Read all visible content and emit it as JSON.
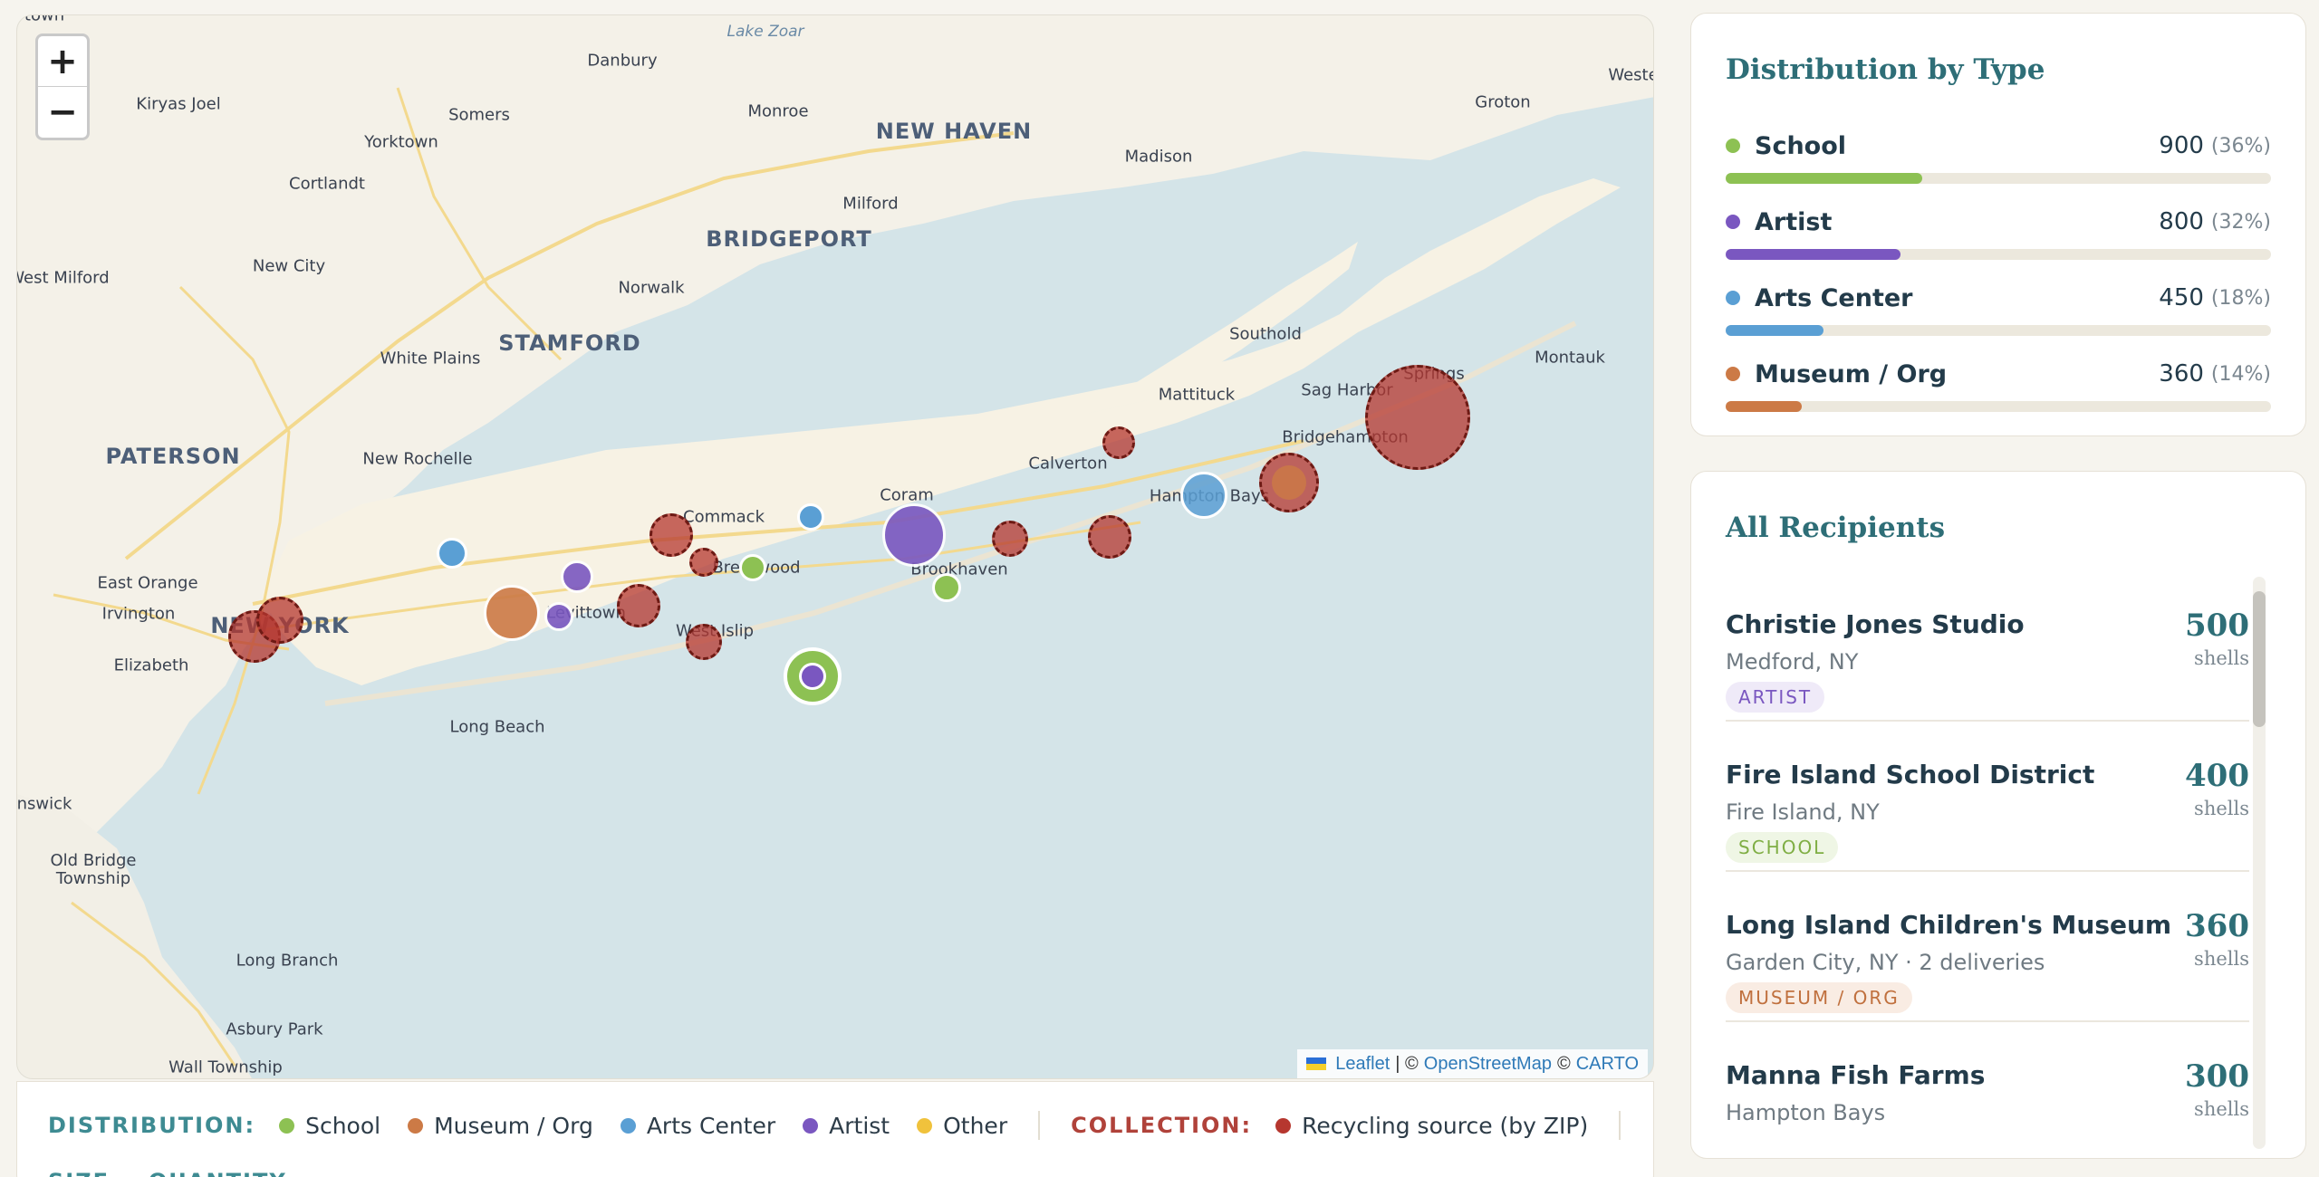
{
  "map": {
    "zoom_in_label": "+",
    "zoom_out_label": "−",
    "attribution": {
      "leaflet": "Leaflet",
      "sep1": "| ©",
      "osm": "OpenStreetMap",
      "sep2": "©",
      "carto": "CARTO"
    },
    "labels": {
      "lake_zoar": "Lake Zoar",
      "town_top_left": "town",
      "danbury": "Danbury",
      "west": "Weste",
      "kiryas_joel": "Kiryas Joel",
      "somers": "Somers",
      "monroe": "Monroe",
      "new_haven": "NEW HAVEN",
      "groton": "Groton",
      "yorktown": "Yorktown",
      "madison": "Madison",
      "cortlandt": "Cortlandt",
      "milford": "Milford",
      "bridgeport": "BRIDGEPORT",
      "new_city": "New City",
      "west_milford": "West Milford",
      "norwalk": "Norwalk",
      "southold": "Southold",
      "stamford": "STAMFORD",
      "white_plains": "White Plains",
      "montauk": "Montauk",
      "springs": "Springs",
      "mattituck": "Mattituck",
      "sag_harbor": "Sag Harbor",
      "bridgehampton": "Bridgehampton",
      "paterson": "PATERSON",
      "new_rochelle": "New Rochelle",
      "calverton": "Calverton",
      "coram": "Coram",
      "hampton_bays": "Hampton Bays",
      "commack": "Commack",
      "east_orange": "East Orange",
      "brentwood": "Brentwood",
      "brookhaven": "Brookhaven",
      "irvington": "Irvington",
      "levittown": "Levittown",
      "new_york": "NEW YORK",
      "west_islip": "West Islip",
      "elizabeth": "Elizabeth",
      "long_beach": "Long Beach",
      "brunswick": "nswick",
      "old_bridge": "Old Bridge\nTownship",
      "long_branch": "Long Branch",
      "asbury_park": "Asbury Park",
      "wall_township": "Wall Township"
    }
  },
  "legend": {
    "distribution_heading": "DISTRIBUTION:",
    "distribution_items": [
      {
        "label": "School",
        "color": "#8dc153"
      },
      {
        "label": "Museum / Org",
        "color": "#cc7a46"
      },
      {
        "label": "Arts Center",
        "color": "#5a9fd4"
      },
      {
        "label": "Artist",
        "color": "#7a57c0"
      },
      {
        "label": "Other",
        "color": "#f0c23c"
      }
    ],
    "collection_heading": "COLLECTION:",
    "collection_items": [
      {
        "label": "Recycling source (by ZIP)",
        "color": "#b6372f"
      }
    ],
    "second_row_heading": "SIZE = QUANTITY"
  },
  "distribution_card": {
    "title": "Distribution by Type",
    "rows": [
      {
        "label": "School",
        "value": "900",
        "pct": "(36%)",
        "fraction": 0.36,
        "color": "#8dc153"
      },
      {
        "label": "Artist",
        "value": "800",
        "pct": "(32%)",
        "fraction": 0.32,
        "color": "#7a57c0"
      },
      {
        "label": "Arts Center",
        "value": "450",
        "pct": "(18%)",
        "fraction": 0.18,
        "color": "#5a9fd4"
      },
      {
        "label": "Museum / Org",
        "value": "360",
        "pct": "(14%)",
        "fraction": 0.14,
        "color": "#cc7a46"
      }
    ]
  },
  "recipients_card": {
    "title": "All Recipients",
    "items": [
      {
        "name": "Christie Jones Studio",
        "location": "Medford, NY",
        "badge": "ARTIST",
        "badge_color": "#7a57c0",
        "badge_bg": "#efeaf8",
        "amount": "500",
        "unit": "shells"
      },
      {
        "name": "Fire Island School District",
        "location": "Fire Island, NY",
        "badge": "SCHOOL",
        "badge_color": "#7fae44",
        "badge_bg": "#eff6e5",
        "amount": "400",
        "unit": "shells"
      },
      {
        "name": "Long Island Children's Museum",
        "location": "Garden City, NY · 2 deliveries",
        "badge": "MUSEUM / ORG",
        "badge_color": "#c0703e",
        "badge_bg": "#f9ece3",
        "amount": "360",
        "unit": "shells"
      },
      {
        "name": "Manna Fish Farms",
        "location": "Hampton Bays",
        "badge": "",
        "badge_color": "#5a9fd4",
        "badge_bg": "#e6f0f9",
        "amount": "300",
        "unit": "shells"
      }
    ]
  }
}
